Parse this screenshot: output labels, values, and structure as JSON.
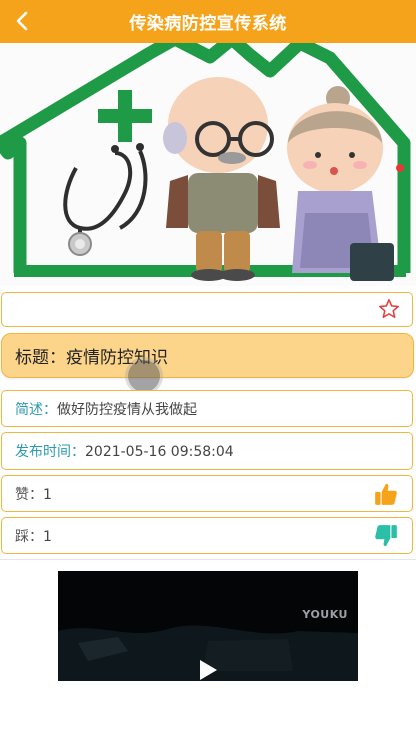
{
  "header": {
    "title": "传染病防控宣传系统",
    "back_icon": "chevron-left-icon",
    "background": "#f5a31b"
  },
  "banner": {
    "description": ""
  },
  "favorite": {
    "icon": "star-outline-icon"
  },
  "article": {
    "title_label": "标题：",
    "title_value": "疫情防控知识",
    "summary_label": "简述：",
    "summary_value": "做好防控疫情从我做起",
    "time_label": "发布时间：",
    "time_value": "2021-05-16 09:58:04"
  },
  "reactions": {
    "like_label": "赞：",
    "like_count": "1",
    "like_icon": "thumbs-up-icon",
    "like_color": "#f5a31b",
    "dislike_label": "踩：",
    "dislike_count": "1",
    "dislike_icon": "thumbs-down-icon",
    "dislike_color": "#2bbfa7"
  },
  "video": {
    "brand": "YOUKU",
    "play_icon": "play-icon"
  }
}
